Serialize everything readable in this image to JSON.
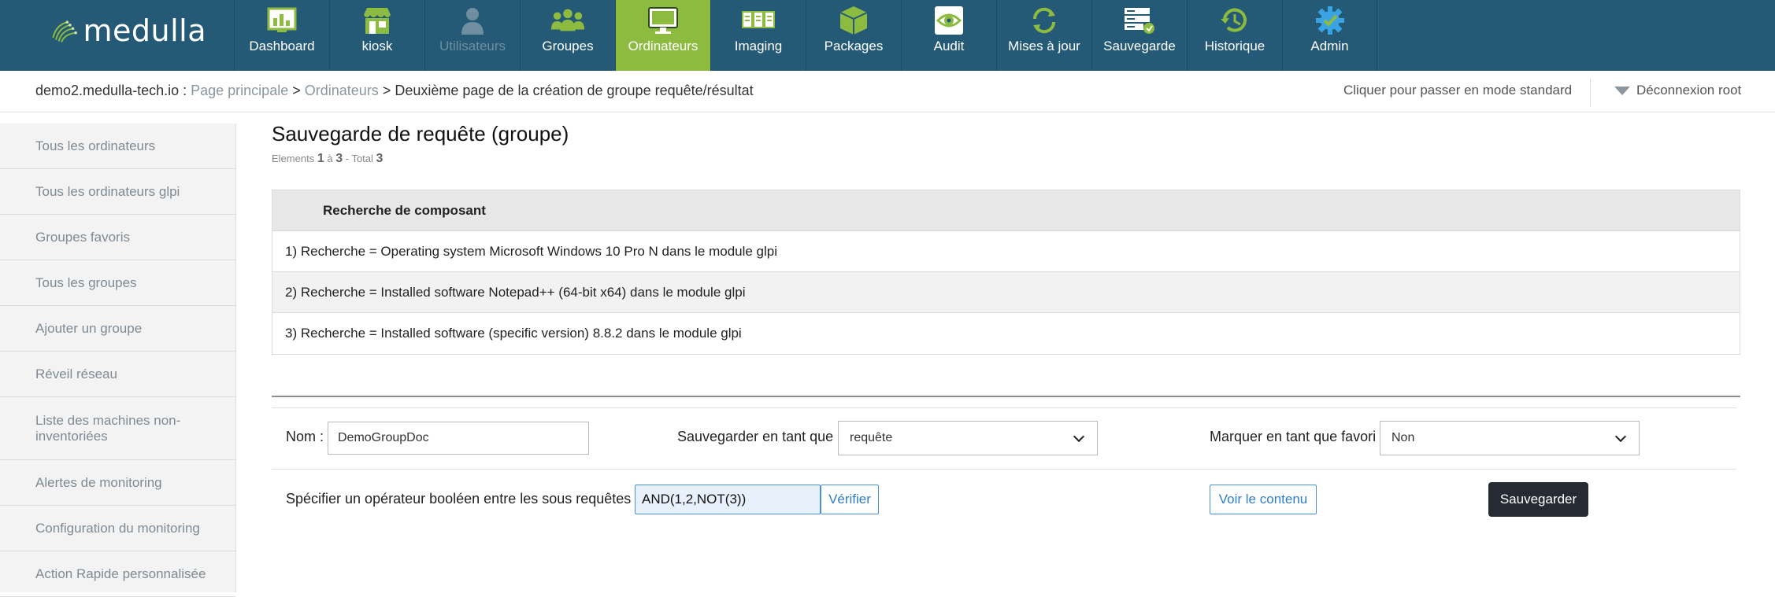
{
  "brand": {
    "name": "medulla"
  },
  "nav": [
    {
      "label": "Dashboard",
      "icon": "dashboard-icon"
    },
    {
      "label": "kiosk",
      "icon": "kiosk-icon"
    },
    {
      "label": "Utilisateurs",
      "icon": "users-icon",
      "disabled": true
    },
    {
      "label": "Groupes",
      "icon": "groups-icon"
    },
    {
      "label": "Ordinateurs",
      "icon": "computer-icon",
      "active": true
    },
    {
      "label": "Imaging",
      "icon": "imaging-icon"
    },
    {
      "label": "Packages",
      "icon": "packages-icon"
    },
    {
      "label": "Audit",
      "icon": "audit-icon"
    },
    {
      "label": "Mises à jour",
      "icon": "updates-icon"
    },
    {
      "label": "Sauvegarde",
      "icon": "backup-icon"
    },
    {
      "label": "Historique",
      "icon": "history-icon"
    },
    {
      "label": "Admin",
      "icon": "admin-icon"
    }
  ],
  "breadcrumb": {
    "host": "demo2.medulla-tech.io :",
    "home": "Page principale",
    "sep1": ">",
    "section": "Ordinateurs",
    "sep2": ">",
    "current": "Deuxième page de la création de groupe requête/résultat"
  },
  "header_links": {
    "mode": "Cliquer pour passer en mode standard",
    "logout": "Déconnexion root"
  },
  "sidebar": {
    "items": [
      "Tous les ordinateurs",
      "Tous les ordinateurs glpi",
      "Groupes favoris",
      "Tous les groupes",
      "Ajouter un groupe",
      "Réveil réseau",
      "Liste des machines non-inventoriées",
      "Alertes de monitoring",
      "Configuration du monitoring",
      "Action Rapide personnalisée"
    ]
  },
  "main": {
    "title": "Sauvegarde de requête (groupe)",
    "pager": {
      "prefix": "Elements",
      "from": "1",
      "to_word": "à",
      "to": "3",
      "total_word": "- Total",
      "total": "3"
    },
    "results_header": "Recherche de composant",
    "results": [
      "1) Recherche = Operating system Microsoft Windows 10 Pro N dans le module glpi",
      "2) Recherche = Installed software Notepad++ (64-bit x64) dans le module glpi",
      "3) Recherche = Installed software (specific version) 8.8.2 dans le module glpi"
    ]
  },
  "form": {
    "name_label": "Nom :",
    "name_value": "DemoGroupDoc",
    "save_as_label": "Sauvegarder en tant que",
    "save_as_value": "requête",
    "favorite_label": "Marquer en tant que favori",
    "favorite_value": "Non",
    "bool_label": "Spécifier un opérateur booléen entre les sous requêtes",
    "bool_value": "AND(1,2,NOT(3))",
    "verify_label": "Vérifier",
    "view_label": "Voir le contenu",
    "save_label": "Sauvegarder"
  },
  "colors": {
    "topbar": "#255a76",
    "active": "#8cbb3f",
    "icon_green": "#8cbb3f",
    "link_blue": "#2f7dc8"
  }
}
